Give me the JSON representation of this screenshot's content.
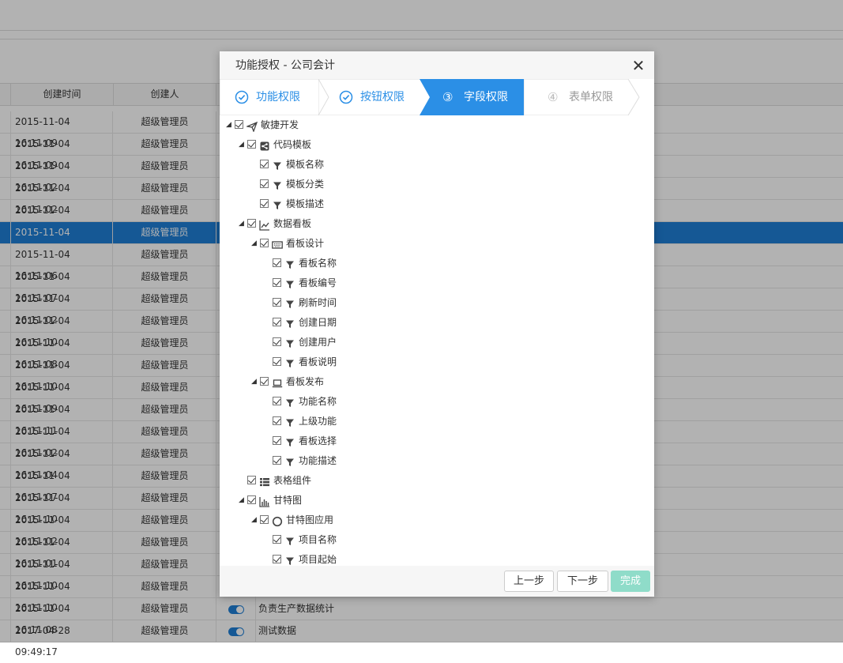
{
  "grid": {
    "headers": [
      "创建时间",
      "创建人"
    ],
    "rows": [
      {
        "time": "2015-11-04 16:11:09",
        "user": "超级管理员",
        "desc": ""
      },
      {
        "time": "2015-11-04 16:11:09",
        "user": "超级管理员",
        "desc": ""
      },
      {
        "time": "2015-11-04 16:11:02",
        "user": "超级管理员",
        "desc": ""
      },
      {
        "time": "2015-11-04 16:11:02",
        "user": "超级管理员",
        "desc": ""
      },
      {
        "time": "2015-11-04 16:11:04",
        "user": "超级管理员",
        "desc": ""
      },
      {
        "time": "2015-11-04 16:11:09",
        "user": "超级管理员",
        "desc": "",
        "selected": true
      },
      {
        "time": "2015-11-04 16:11:06",
        "user": "超级管理员",
        "desc": ""
      },
      {
        "time": "2015-11-04 16:11:07",
        "user": "超级管理员",
        "desc": ""
      },
      {
        "time": "2015-11-04 16:11:02",
        "user": "超级管理员",
        "desc": ""
      },
      {
        "time": "2015-11-04 16:11:10",
        "user": "超级管理员",
        "desc": ""
      },
      {
        "time": "2015-11-04 16:11:08",
        "user": "超级管理员",
        "desc": ""
      },
      {
        "time": "2015-11-04 16:11:10",
        "user": "超级管理员",
        "desc": ""
      },
      {
        "time": "2015-11-04 16:11:09",
        "user": "超级管理员",
        "desc": ""
      },
      {
        "time": "2015-11-04 16:11:11",
        "user": "超级管理员",
        "desc": ""
      },
      {
        "time": "2015-11-04 16:11:02",
        "user": "超级管理员",
        "desc": ""
      },
      {
        "time": "2015-11-04 16:11:04",
        "user": "超级管理员",
        "desc": ""
      },
      {
        "time": "2015-11-04 16:11:07",
        "user": "超级管理员",
        "desc": ""
      },
      {
        "time": "2015-11-04 16:11:10",
        "user": "超级管理员",
        "desc": ""
      },
      {
        "time": "2015-11-04 16:11:02",
        "user": "超级管理员",
        "desc": ""
      },
      {
        "time": "2015-11-04 16:11:01",
        "user": "超级管理员",
        "desc": ""
      },
      {
        "time": "2015-11-04 16:11:10",
        "user": "超级管理员",
        "desc": ""
      },
      {
        "time": "2015-11-04 16:11:10",
        "user": "超级管理员",
        "desc": ""
      },
      {
        "time": "2015-11-04 16:11:08",
        "user": "超级管理员",
        "desc": "负责生产数据统计",
        "toggle": true
      },
      {
        "time": "2017-04-28 09:49:17",
        "user": "超级管理员",
        "desc": "测试数据",
        "toggle": true
      }
    ]
  },
  "dialog": {
    "title": "功能授权 - 公司会计",
    "close_icon": "close-icon",
    "steps": [
      {
        "label": "功能权限",
        "state": "done",
        "marker": ""
      },
      {
        "label": "按钮权限",
        "state": "done",
        "marker": ""
      },
      {
        "label": "字段权限",
        "state": "active",
        "marker": "③"
      },
      {
        "label": "表单权限",
        "state": "todo",
        "marker": "④"
      }
    ],
    "tree": [
      {
        "label": "敏捷开发",
        "level": 0,
        "expanded": true,
        "icon": "send-icon"
      },
      {
        "label": "代码模板",
        "level": 1,
        "expanded": true,
        "icon": "share-icon"
      },
      {
        "label": "模板名称",
        "level": 2,
        "icon": "filter-icon"
      },
      {
        "label": "模板分类",
        "level": 2,
        "icon": "filter-icon"
      },
      {
        "label": "模板描述",
        "level": 2,
        "icon": "filter-icon"
      },
      {
        "label": "数据看板",
        "level": 1,
        "expanded": true,
        "icon": "line-chart-icon"
      },
      {
        "label": "看板设计",
        "level": 2,
        "expanded": true,
        "icon": "keyboard-icon"
      },
      {
        "label": "看板名称",
        "level": 3,
        "icon": "filter-icon"
      },
      {
        "label": "看板编号",
        "level": 3,
        "icon": "filter-icon"
      },
      {
        "label": "刷新时间",
        "level": 3,
        "icon": "filter-icon"
      },
      {
        "label": "创建日期",
        "level": 3,
        "icon": "filter-icon"
      },
      {
        "label": "创建用户",
        "level": 3,
        "icon": "filter-icon"
      },
      {
        "label": "看板说明",
        "level": 3,
        "icon": "filter-icon"
      },
      {
        "label": "看板发布",
        "level": 2,
        "expanded": true,
        "icon": "laptop-icon"
      },
      {
        "label": "功能名称",
        "level": 3,
        "icon": "filter-icon"
      },
      {
        "label": "上级功能",
        "level": 3,
        "icon": "filter-icon"
      },
      {
        "label": "看板选择",
        "level": 3,
        "icon": "filter-icon"
      },
      {
        "label": "功能描述",
        "level": 3,
        "icon": "filter-icon"
      },
      {
        "label": "表格组件",
        "level": 1,
        "icon": "list-icon"
      },
      {
        "label": "甘特图",
        "level": 1,
        "expanded": true,
        "icon": "bar-chart-icon"
      },
      {
        "label": "甘特图应用",
        "level": 2,
        "expanded": true,
        "icon": "circle-icon"
      },
      {
        "label": "项目名称",
        "level": 3,
        "icon": "filter-icon"
      },
      {
        "label": "项目起始",
        "level": 3,
        "icon": "filter-icon"
      }
    ],
    "buttons": {
      "prev": "上一步",
      "next": "下一步",
      "done": "完成"
    }
  },
  "colors": {
    "accent": "#1f7fd6",
    "step_active": "#2b8fe6",
    "done_button": "#8fdcc9"
  }
}
